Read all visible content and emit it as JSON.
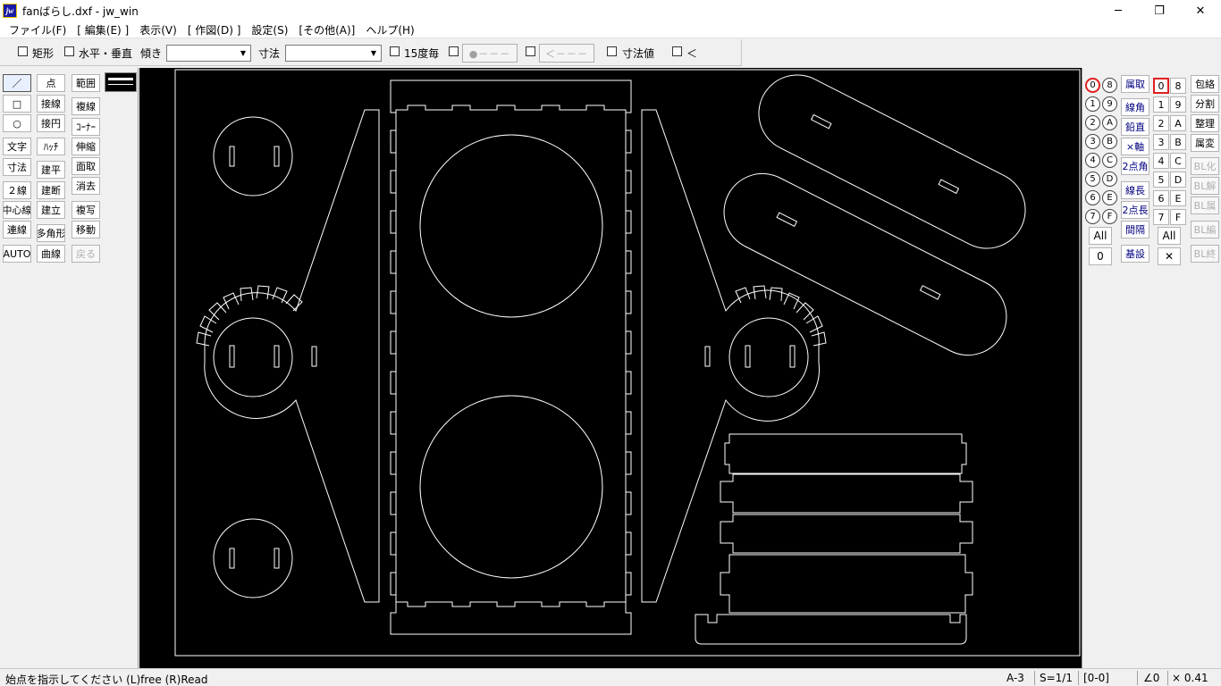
{
  "window": {
    "logo": "jw",
    "title": "fanばらし.dxf - jw_win",
    "minimize": "─",
    "maximize": "❐",
    "close": "✕"
  },
  "menu": [
    "ファイル(F)",
    "[ 編集(E) ]",
    "表示(V)",
    "[ 作図(D) ]",
    "設定(S)",
    "[その他(A)]",
    "ヘルプ(H)"
  ],
  "controlbar": {
    "rect_label": "矩形",
    "hv_label": "水平・垂直",
    "tilt_label": "傾き",
    "tilt_value": "",
    "dim_label": "寸法",
    "dim_value": "",
    "deg15_label": "15度毎",
    "dot_button": "●－－－",
    "arrow_button": "＜－－－",
    "dimval_label": "寸法値",
    "lt_label": "＜"
  },
  "left_tools": {
    "col1": [
      "／",
      "□",
      "○",
      "文字",
      "寸法",
      "２線",
      "中心線",
      "連線",
      "AUTO"
    ],
    "col2": [
      "点",
      "接線",
      "接円",
      "ﾊｯﾁ",
      "建平",
      "建断",
      "建立",
      "多角形",
      "曲線"
    ],
    "col3": [
      "範囲",
      "複線",
      "ｺｰﾅｰ",
      "伸縮",
      "面取",
      "消去",
      "複写",
      "移動",
      "戻る"
    ]
  },
  "right_panel": {
    "layer_circles_left": [
      "0",
      "1",
      "2",
      "3",
      "4",
      "5",
      "6",
      "7"
    ],
    "layer_circles_right": [
      "8",
      "9",
      "A",
      "B",
      "C",
      "D",
      "E",
      "F"
    ],
    "circle_all": "All",
    "circle_zero": "0",
    "tools": [
      "属取",
      "線角",
      "鉛直",
      "×軸",
      "2点角",
      "線長",
      "2点長",
      "間隔",
      "基設"
    ],
    "layer_grid_left": [
      "0",
      "1",
      "2",
      "3",
      "4",
      "5",
      "6",
      "7"
    ],
    "layer_grid_right": [
      "8",
      "9",
      "A",
      "B",
      "C",
      "D",
      "E",
      "F"
    ],
    "grid_all": "All",
    "grid_x": "✕",
    "tools2": [
      "包絡",
      "分割",
      "整理",
      "属変",
      "BL化",
      "BL解",
      "BL属",
      "BL編",
      "BL終"
    ]
  },
  "status": {
    "message": "始点を指示してください (L)free (R)Read",
    "paper": "A-3",
    "scale": "S=1/1",
    "layer": "[0-0]",
    "angle": "∠0",
    "zoom": "× 0.41"
  },
  "colors": {
    "canvas": "#000000",
    "drawing_lines": "#ffffff",
    "current_layer": "#e02020",
    "tool_text": "#000080"
  }
}
